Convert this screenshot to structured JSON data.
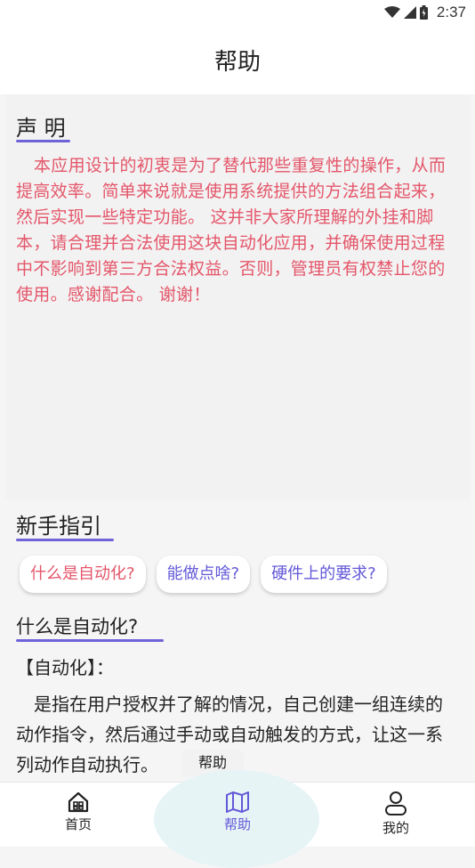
{
  "status": {
    "time": "2:37"
  },
  "appbar": {
    "title": "帮助"
  },
  "declaration": {
    "title": "声 明",
    "text": "本应用设计的初衷是为了替代那些重复性的操作，从而提高效率。简单来说就是使用系统提供的方法组合起来，然后实现一些特定功能。 这并非大家所理解的外挂和脚本，请合理并合法使用这块自动化应用，并确保使用过程中不影响到第三方合法权益。否则，管理员有权禁止您的使用。感谢配合。 谢谢！"
  },
  "guide": {
    "title": "新手指引",
    "chips": [
      {
        "label": "什么是自动化?"
      },
      {
        "label": "能做点啥?"
      },
      {
        "label": "硬件上的要求?"
      }
    ],
    "question_title": "什么是自动化?",
    "question_sub": "【自动化】：",
    "question_body": "是指在用户授权并了解的情况，自己创建一组连续的动作指令，然后通过手动或自动触发的方式，让这一系列动作自动执行。"
  },
  "toast": {
    "text": "帮助"
  },
  "bottom_nav": {
    "items": [
      {
        "label": "首页",
        "icon": "home-icon"
      },
      {
        "label": "帮助",
        "icon": "map-icon"
      },
      {
        "label": "我的",
        "icon": "user-icon"
      }
    ]
  },
  "colors": {
    "accent": "#6358d8",
    "warning_text": "#e4566a",
    "nav_highlight": "#e6f4f6"
  }
}
